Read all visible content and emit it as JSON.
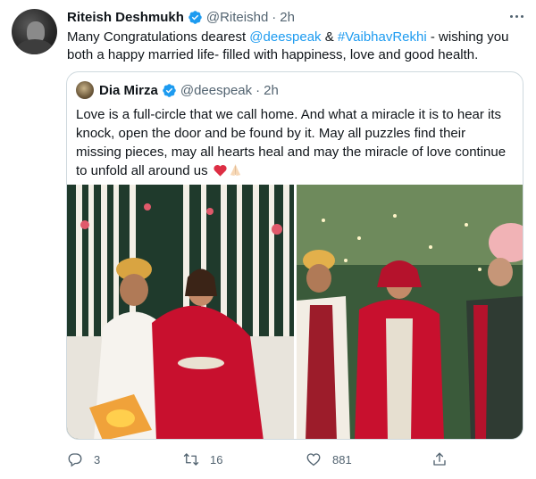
{
  "tweet": {
    "author_name": "Riteish Deshmukh",
    "author_handle": "@Riteishd",
    "separator": "·",
    "time": "2h",
    "text_before": "Many Congratulations dearest ",
    "mention_1": "@deespeak",
    "text_amp": " & ",
    "hashtag": "#VaibhavRekhi",
    "text_after": " - wishing you both a happy married life- filled with happiness, love and good health."
  },
  "quoted_tweet": {
    "author_name": "Dia Mirza",
    "author_handle": "@deespeak",
    "separator": "·",
    "time": "2h",
    "text": "Love is a full-circle that we call home. And what a miracle it is to hear its knock, open the door and be found by it. May all puzzles find their missing pieces, may all hearts heal and may the miracle of love continue to unfold all around us",
    "emojis": [
      "heart-emoji",
      "folded-hands-emoji"
    ]
  },
  "actions": {
    "reply_count": "3",
    "retweet_count": "16",
    "like_count": "881"
  },
  "colors": {
    "link": "#1d9bf0",
    "secondary_text": "#536471",
    "verified": "#1d9bf0",
    "border": "#cfd9de",
    "bridal_red": "#c8102e"
  },
  "icons": [
    "verified-badge-icon",
    "more-options-icon",
    "reply-icon",
    "retweet-icon",
    "like-icon",
    "share-icon"
  ]
}
